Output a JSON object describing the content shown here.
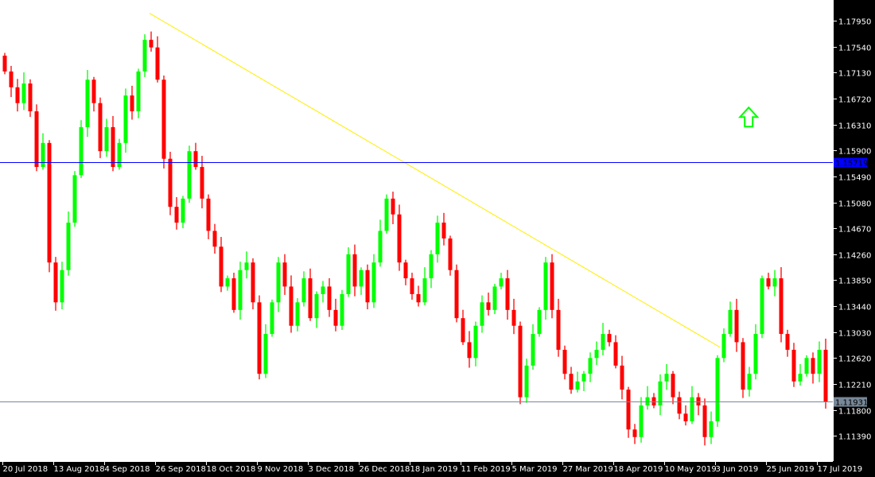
{
  "chart_data": {
    "type": "candlestick",
    "symbol_note": "",
    "ylim": [
      1.1099,
      1.1828
    ],
    "y_ticks": [
      "1.17950",
      "1.17540",
      "1.17130",
      "1.16720",
      "1.16310",
      "1.15900",
      "1.15490",
      "1.15080",
      "1.14670",
      "1.14260",
      "1.13850",
      "1.13440",
      "1.13030",
      "1.12620",
      "1.12210",
      "1.11800",
      "1.11390"
    ],
    "x_ticks": [
      "20 Jul 2018",
      "13 Aug 2018",
      "4 Sep 2018",
      "26 Sep 2018",
      "18 Oct 2018",
      "9 Nov 2018",
      "3 Dec 2018",
      "26 Dec 2018",
      "18 Jan 2019",
      "11 Feb 2019",
      "5 Mar 2019",
      "27 Mar 2019",
      "18 Apr 2019",
      "10 May 2019",
      "3 Jun 2019",
      "25 Jun 2019",
      "17 Jul 2019"
    ],
    "first_open": 1.174,
    "close": [
      1.1715,
      1.169,
      1.1665,
      1.1696,
      1.1652,
      1.1564,
      1.1602,
      1.1413,
      1.135,
      1.1401,
      1.1476,
      1.1551,
      1.1627,
      1.1702,
      1.1665,
      1.1589,
      1.1627,
      1.1564,
      1.1602,
      1.1677,
      1.1652,
      1.1715,
      1.1765,
      1.1753,
      1.1702,
      1.1577,
      1.1501,
      1.1476,
      1.1514,
      1.1589,
      1.1564,
      1.1514,
      1.1463,
      1.1438,
      1.1375,
      1.1388,
      1.1338,
      1.1401,
      1.1413,
      1.135,
      1.1237,
      1.13,
      1.135,
      1.1413,
      1.1375,
      1.1313,
      1.135,
      1.1388,
      1.1325,
      1.1363,
      1.1375,
      1.1338,
      1.1313,
      1.1363,
      1.1426,
      1.1375,
      1.1401,
      1.135,
      1.1413,
      1.1463,
      1.1514,
      1.1489,
      1.1413,
      1.1388,
      1.1363,
      1.135,
      1.1388,
      1.1426,
      1.1476,
      1.1451,
      1.1401,
      1.1325,
      1.1287,
      1.1262,
      1.1313,
      1.135,
      1.1338,
      1.1375,
      1.1388,
      1.1338,
      1.1313,
      1.12,
      1.125,
      1.13,
      1.1338,
      1.1413,
      1.1338,
      1.1275,
      1.1237,
      1.1212,
      1.1225,
      1.1237,
      1.1262,
      1.1275,
      1.13,
      1.1287,
      1.125,
      1.1212,
      1.1149,
      1.1137,
      1.1187,
      1.12,
      1.1187,
      1.1225,
      1.1237,
      1.12,
      1.1174,
      1.1162,
      1.12,
      1.1187,
      1.1137,
      1.1162,
      1.1262,
      1.13,
      1.1338,
      1.1287,
      1.1212,
      1.1237,
      1.13,
      1.1388,
      1.1375,
      1.1388,
      1.13,
      1.1275,
      1.1225,
      1.1237,
      1.1262,
      1.1237,
      1.1275,
      1.1193
    ],
    "trendline": {
      "start_bar": 22.75,
      "start_price": 1.1807,
      "end_bar": 112.4,
      "end_price": 1.1279
    },
    "hlines": [
      {
        "price": 1.15719,
        "label": "1.15719"
      },
      {
        "price": 1.11931,
        "label": "1.11931"
      }
    ],
    "arrow": {
      "bar": 116.9,
      "price": 1.1643
    }
  },
  "colors": {
    "bull": "#00ff00",
    "bear": "#ff0000",
    "trend": "#ffee00",
    "blue_line": "#0000ff",
    "gray_line": "#778899",
    "plot_bg": "#ffffff"
  }
}
